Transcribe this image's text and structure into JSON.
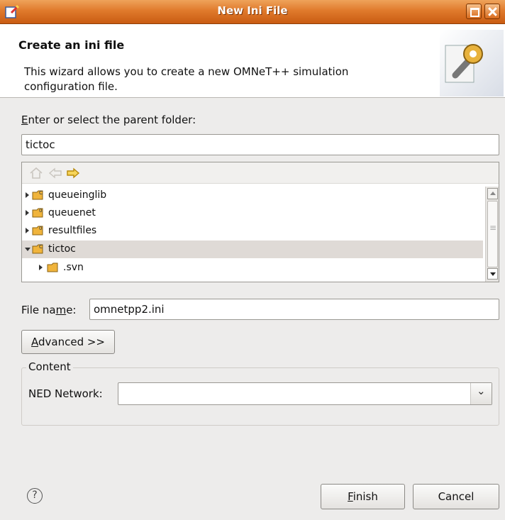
{
  "window": {
    "title": "New Ini File"
  },
  "header": {
    "title": "Create an ini file",
    "description": "This wizard allows you to create a new OMNeT++ simulation configuration file."
  },
  "parent_folder": {
    "label_mnemonic": "E",
    "label_rest": "nter or select the parent folder:",
    "value": "tictoc"
  },
  "tree": {
    "items": [
      {
        "label": "queueinglib",
        "expanded": false,
        "selected": false,
        "depth": 0
      },
      {
        "label": "queuenet",
        "expanded": false,
        "selected": false,
        "depth": 0
      },
      {
        "label": "resultfiles",
        "expanded": false,
        "selected": false,
        "depth": 0
      },
      {
        "label": "tictoc",
        "expanded": true,
        "selected": true,
        "depth": 0
      },
      {
        "label": ".svn",
        "expanded": false,
        "selected": false,
        "depth": 1
      }
    ]
  },
  "file_name": {
    "label_pre": "File na",
    "label_mnemonic": "m",
    "label_post": "e:",
    "value": "omnetpp2.ini"
  },
  "advanced_button": {
    "label_mnemonic": "A",
    "label_rest": "dvanced >>"
  },
  "content_group": {
    "title": "Content",
    "ned_network_label": "NED Network:",
    "ned_network_value": ""
  },
  "footer": {
    "finish_mnemonic": "F",
    "finish_rest": "inish",
    "cancel_label": "Cancel"
  },
  "colors": {
    "titlebar": "#e07a2c",
    "selection": "#dfdad6",
    "folder": "#f0b43c"
  }
}
